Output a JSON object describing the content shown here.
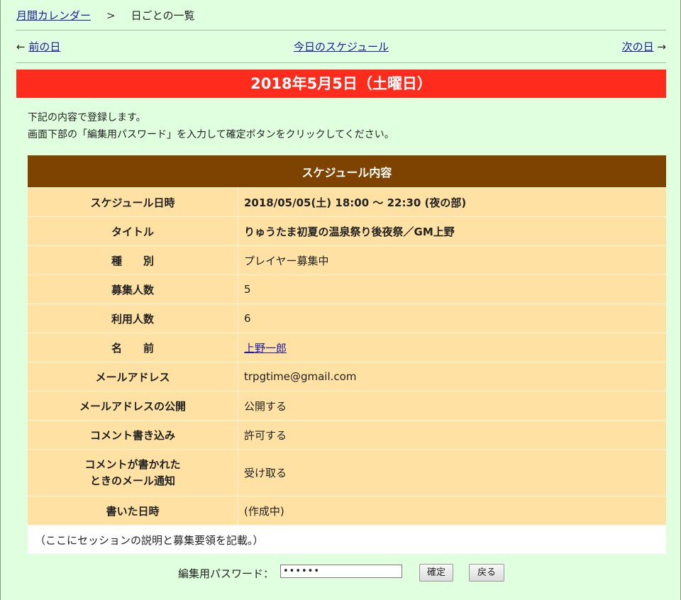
{
  "breadcrumb": {
    "calendar_link": "月間カレンダー",
    "separator": ">",
    "current": "日ごとの一覧"
  },
  "nav": {
    "prev_arrow": "←",
    "prev_label": "前の日",
    "today_label": "今日のスケジュール",
    "next_label": "次の日",
    "next_arrow": "→"
  },
  "date_title": "2018年5月5日（土曜日）",
  "intro": {
    "line1": "下記の内容で登録します。",
    "line2": "画面下部の「編集用パスワード」を入力して確定ボタンをクリックしてください。"
  },
  "schedule": {
    "header": "スケジュール内容",
    "rows": [
      {
        "label": "スケジュール日時",
        "value": "2018/05/05(土) 18:00 ～ 22:30 (夜の部)"
      },
      {
        "label": "タイトル",
        "value": "りゅうたま初夏の温泉祭り後夜祭／GM上野"
      },
      {
        "label": "種　　別",
        "value": "プレイヤー募集中"
      },
      {
        "label": "募集人数",
        "value": "5"
      },
      {
        "label": "利用人数",
        "value": "6"
      },
      {
        "label": "名　　前",
        "value": "上野一郎"
      },
      {
        "label": "メールアドレス",
        "value": "trpgtime@gmail.com"
      },
      {
        "label": "メールアドレスの公開",
        "value": "公開する"
      },
      {
        "label": "コメント書き込み",
        "value": "許可する"
      },
      {
        "label_line1": "コメントが書かれた",
        "label_line2": "ときのメール通知",
        "value": "受け取る"
      },
      {
        "label": "書いた日時",
        "value": "(作成中)"
      }
    ],
    "description": "（ここにセッションの説明と募集要領を記載。）"
  },
  "password": {
    "label": "編集用パスワード：",
    "value": "••••••"
  },
  "buttons": {
    "confirm": "確定",
    "back": "戻る"
  }
}
